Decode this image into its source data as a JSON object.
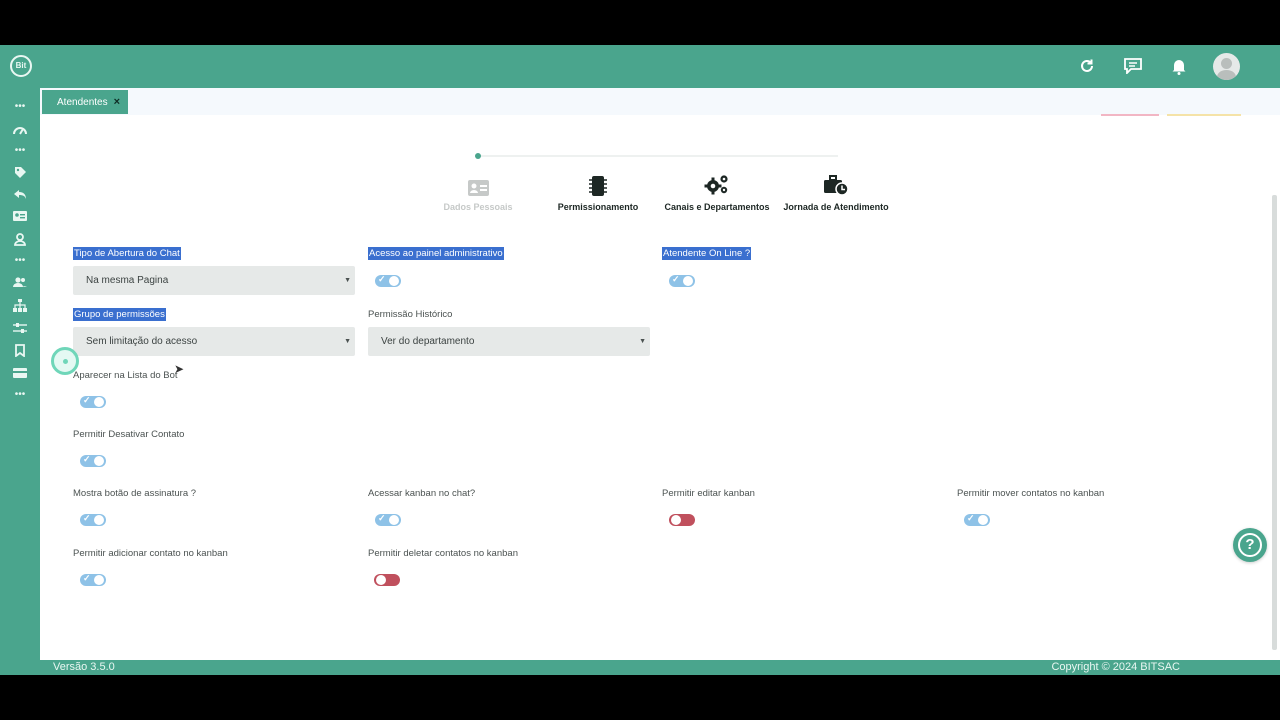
{
  "app": {
    "logo_text": "Bit",
    "accent_color": "#4aa58d"
  },
  "header": {
    "icons": [
      "refresh-icon",
      "chat-icon",
      "bell-icon",
      "user-avatar"
    ]
  },
  "sidebar": {
    "items": [
      "dots-icon",
      "dashboard-icon",
      "dots-icon",
      "tag-icon",
      "reply-icon",
      "id-card-icon",
      "user-icon",
      "dots-icon",
      "users-icon",
      "sitemap-icon",
      "sliders-icon",
      "bookmark-icon",
      "card-icon",
      "dots-icon"
    ]
  },
  "tabs": [
    {
      "label": "Atendentes",
      "close": "×"
    }
  ],
  "stepper": {
    "steps": [
      {
        "label": "Dados Pessoais",
        "state": "inactive"
      },
      {
        "label": "Permissionamento",
        "state": "active"
      },
      {
        "label": "Canais e Departamentos",
        "state": "active"
      },
      {
        "label": "Jornada de Atendimento",
        "state": "active"
      }
    ]
  },
  "form": {
    "tipo_abertura": {
      "label": "Tipo de Abertura do Chat",
      "value": "Na mesma Pagina"
    },
    "acesso_painel": {
      "label": "Acesso ao painel administrativo",
      "on": true
    },
    "atendente_online": {
      "label": "Atendente On Line ?",
      "on": true
    },
    "grupo_permissoes": {
      "label": "Grupo de permissões",
      "value": "Sem limitação do acesso"
    },
    "permissao_historico": {
      "label": "Permissão Histórico",
      "value": "Ver do departamento"
    },
    "aparecer_bot": {
      "label": "Aparecer na Lista do Bot",
      "on": true
    },
    "desativar_contato": {
      "label": "Permitir Desativar Contato",
      "on": true
    },
    "botao_assinatura": {
      "label": "Mostra botão de assinatura ?",
      "on": true
    },
    "kanban_chat": {
      "label": "Acessar kanban no chat?",
      "on": true
    },
    "editar_kanban": {
      "label": "Permitir editar kanban",
      "on": false
    },
    "mover_kanban": {
      "label": "Permitir mover contatos no kanban",
      "on": true
    },
    "adicionar_kanban": {
      "label": "Permitir adicionar contato no kanban",
      "on": true
    },
    "deletar_kanban": {
      "label": "Permitir deletar contatos no kanban",
      "on": false
    }
  },
  "footer": {
    "version": "Versão 3.5.0",
    "copyright": "Copyright © 2024 BITSAC"
  }
}
